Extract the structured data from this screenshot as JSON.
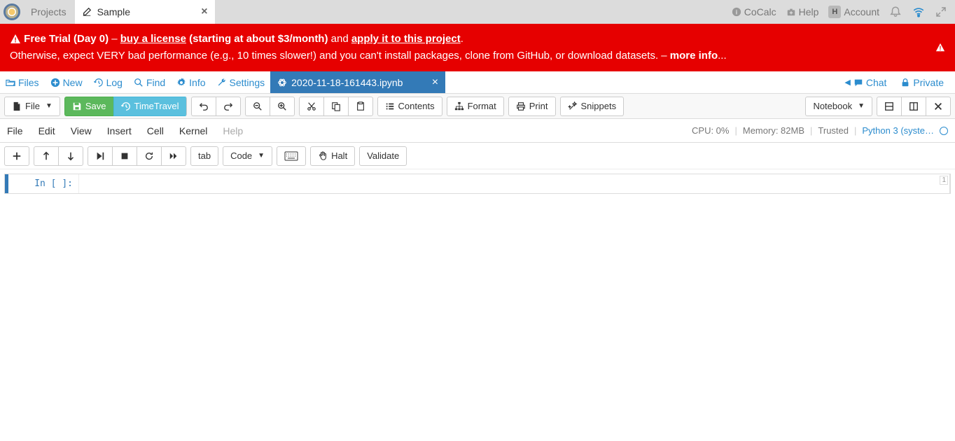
{
  "topbar": {
    "projects": "Projects",
    "tab_name": "Sample",
    "cocalc": "CoCalc",
    "help": "Help",
    "account": "Account",
    "account_letter": "H"
  },
  "banner": {
    "warn_prefix": "Free Trial (Day 0)",
    "dash": " – ",
    "buy_license": "buy a license",
    "starting": " (starting at about $3/month) ",
    "and": "and ",
    "apply": "apply it to this project",
    "period": ".",
    "line2_a": "Otherwise, expect VERY bad performance (e.g., 10 times slower!) and you can't install packages, clone from GitHub, or download datasets. – ",
    "more_info": "more info",
    "ellipsis": "..."
  },
  "filetabs": {
    "files": "Files",
    "new": "New",
    "log": "Log",
    "find": "Find",
    "info": "Info",
    "settings": "Settings",
    "filename": "2020-11-18-161443.ipynb",
    "chat": "Chat",
    "private": "Private"
  },
  "toolbar": {
    "file": "File",
    "save": "Save",
    "timetravel": "TimeTravel",
    "contents": "Contents",
    "format": "Format",
    "print": "Print",
    "snippets": "Snippets",
    "notebook": "Notebook"
  },
  "menubar": {
    "file": "File",
    "edit": "Edit",
    "view": "View",
    "insert": "Insert",
    "cell": "Cell",
    "kernel": "Kernel",
    "help": "Help",
    "cpu": "CPU: 0%",
    "memory": "Memory: 82MB",
    "trusted": "Trusted",
    "kernel_name": "Python 3 (syste…"
  },
  "actionrow": {
    "tab": "tab",
    "code": "Code",
    "halt": "Halt",
    "validate": "Validate"
  },
  "cell": {
    "prompt": "In [ ]:",
    "count": "1"
  }
}
